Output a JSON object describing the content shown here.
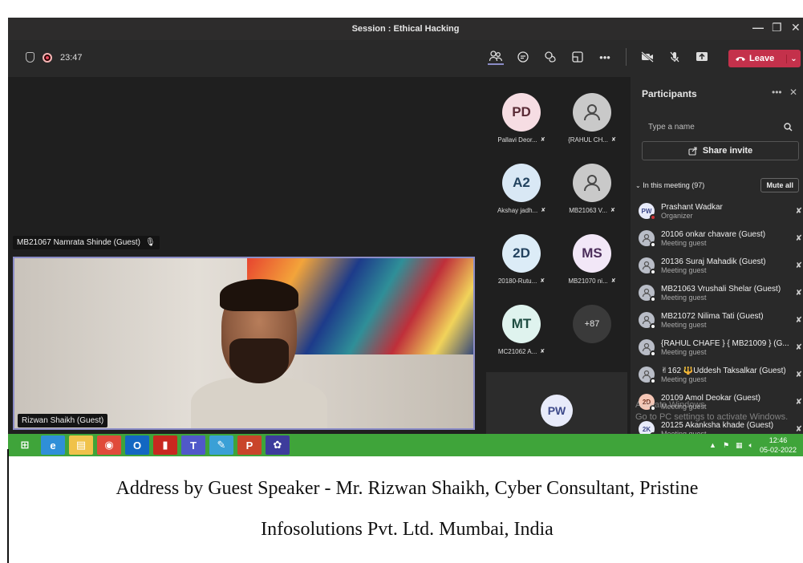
{
  "window": {
    "title": "Session : Ethical Hacking",
    "min": "—",
    "max": "❐",
    "close": "✕"
  },
  "toolbar": {
    "timer": "23:47",
    "more": "•••",
    "leave": "Leave"
  },
  "stage": {
    "tag_top": "MB21067 Namrata Shinde (Guest)",
    "video_tag": "Rizwan Shaikh (Guest)"
  },
  "gallery": [
    {
      "initials": "PD",
      "name": "Pallavi Deor...",
      "bg": "#f6dde3",
      "fg": "#5a2b36"
    },
    {
      "initials": "",
      "name": "{RAHUL CH...",
      "bg": "#c9c9c9",
      "fg": "#4a4a4a"
    },
    {
      "initials": "A2",
      "name": "Akshay jadh...",
      "bg": "#d9e8f5",
      "fg": "#23435f"
    },
    {
      "initials": "",
      "name": "MB21063 V...",
      "bg": "#c9c9c9",
      "fg": "#4a4a4a"
    },
    {
      "initials": "2D",
      "name": "20180-Rutu...",
      "bg": "#dcecf7",
      "fg": "#23435f"
    },
    {
      "initials": "MS",
      "name": "MB21070 ni...",
      "bg": "#f2e7f7",
      "fg": "#4b2d5a"
    },
    {
      "initials": "MT",
      "name": "MC21062 A...",
      "bg": "#dff3ee",
      "fg": "#1f4d42"
    },
    {
      "initials": "+87",
      "name": "",
      "bg": "#3a3a3a",
      "fg": "#e6e6e6"
    }
  ],
  "self_tile": {
    "initials": "PW"
  },
  "panel": {
    "title": "Participants",
    "more": "•••",
    "close": "✕",
    "search_placeholder": "Type a name",
    "share_invite": "Share invite",
    "in_meeting": "In this meeting (97)",
    "mute_all": "Mute all",
    "people": [
      {
        "initials": "PW",
        "name": "Prashant Wadkar",
        "role": "Organizer",
        "dot": "red"
      },
      {
        "initials": "",
        "name": "20106 onkar chavare (Guest)",
        "role": "Meeting guest",
        "dot": "white"
      },
      {
        "initials": "",
        "name": "20136 Suraj Mahadik (Guest)",
        "role": "Meeting guest",
        "dot": "white"
      },
      {
        "initials": "",
        "name": "MB21063 Vrushali Shelar (Guest)",
        "role": "Meeting guest",
        "dot": "white"
      },
      {
        "initials": "",
        "name": "MB21072 Nilima Tati (Guest)",
        "role": "Meeting guest",
        "dot": "white"
      },
      {
        "initials": "",
        "name": "{RAHUL CHAFE } { MB21009 } (G...",
        "role": "Meeting guest",
        "dot": "white"
      },
      {
        "initials": "",
        "name": "✌162 🔱Uddesh Taksalkar (Guest)",
        "role": "Meeting guest",
        "dot": "white"
      },
      {
        "initials": "2D",
        "name": "20109 Amol Deokar (Guest)",
        "role": "Meeting guest",
        "dot": "white"
      },
      {
        "initials": "2K",
        "name": "20125 Akanksha khade (Guest)",
        "role": "Meeting guest",
        "dot": "white"
      }
    ]
  },
  "watermark": {
    "line1": "Activate Windows",
    "line2": "Go to PC settings to activate Windows."
  },
  "taskbar": {
    "apps": [
      {
        "name": "windows-start",
        "glyph": "⊞",
        "bg": "#3fa43a"
      },
      {
        "name": "internet-explorer",
        "glyph": "e",
        "bg": "#2f8fd8"
      },
      {
        "name": "file-explorer",
        "glyph": "▤",
        "bg": "#f0c24a"
      },
      {
        "name": "chrome",
        "glyph": "◉",
        "bg": "#e04b3a"
      },
      {
        "name": "outlook",
        "glyph": "O",
        "bg": "#1367c2"
      },
      {
        "name": "pdf-reader",
        "glyph": "▮",
        "bg": "#c8281f"
      },
      {
        "name": "teams",
        "glyph": "T",
        "bg": "#5059c9"
      },
      {
        "name": "notes",
        "glyph": "✎",
        "bg": "#3aa0d6"
      },
      {
        "name": "powerpoint",
        "glyph": "P",
        "bg": "#c9452a"
      },
      {
        "name": "settings",
        "glyph": "✿",
        "bg": "#3d3c9c"
      }
    ],
    "time": "12:46",
    "date": "05-02-2022"
  },
  "caption": {
    "line1": "Address by Guest Speaker - Mr. Rizwan Shaikh, Cyber Consultant, Pristine",
    "line2": "Infosolutions Pvt. Ltd. Mumbai, India"
  }
}
